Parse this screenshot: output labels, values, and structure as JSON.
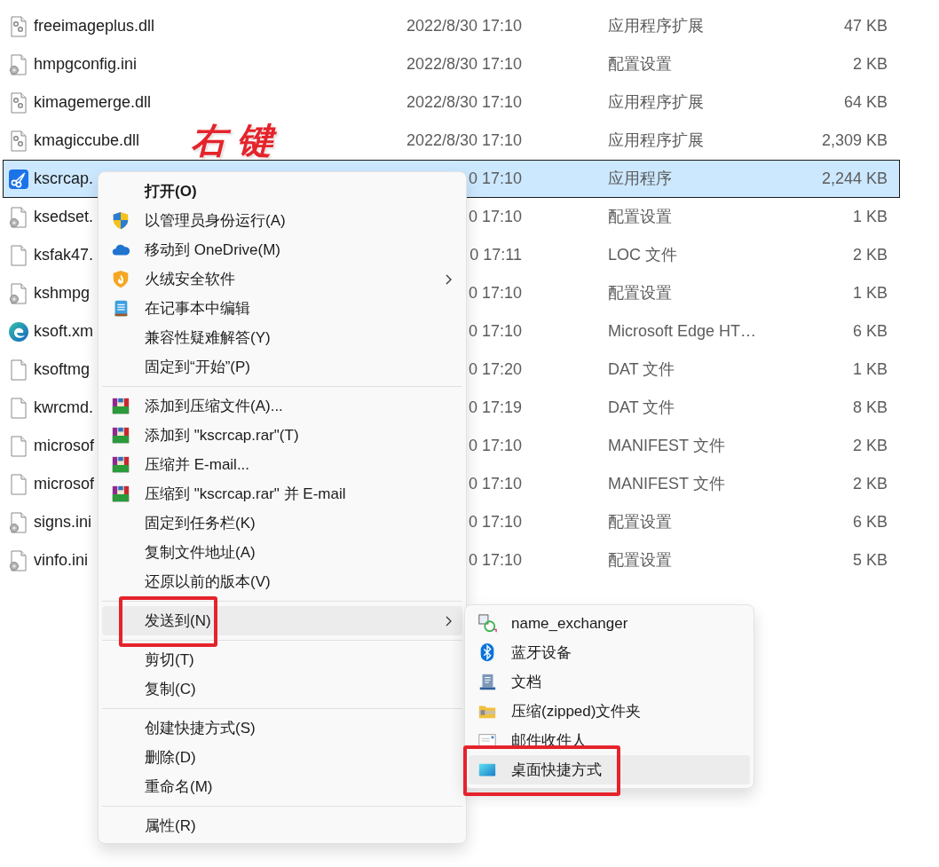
{
  "files": [
    {
      "name": "freeimageplus.dll",
      "date": "2022/8/30 17:10",
      "type": "应用程序扩展",
      "size": "47 KB",
      "kind": "dll",
      "selected": false
    },
    {
      "name": "hmpgconfig.ini",
      "date": "2022/8/30 17:10",
      "type": "配置设置",
      "size": "2 KB",
      "kind": "ini",
      "selected": false
    },
    {
      "name": "kimagemerge.dll",
      "date": "2022/8/30 17:10",
      "type": "应用程序扩展",
      "size": "64 KB",
      "kind": "dll",
      "selected": false
    },
    {
      "name": "kmagiccube.dll",
      "date": "2022/8/30 17:10",
      "type": "应用程序扩展",
      "size": "2,309 KB",
      "kind": "dll",
      "selected": false,
      "annotation": "右键"
    },
    {
      "name": "kscrcap.",
      "date": "0 17:10",
      "type": "应用程序",
      "size": "2,244 KB",
      "kind": "scissors",
      "selected": true
    },
    {
      "name": "ksedset.",
      "date": "0 17:10",
      "type": "配置设置",
      "size": "1 KB",
      "kind": "ini",
      "selected": false
    },
    {
      "name": "ksfak47.",
      "date": "0 17:11",
      "type": "LOC 文件",
      "size": "2 KB",
      "kind": "blank",
      "selected": false
    },
    {
      "name": "kshmpg",
      "date": "0 17:10",
      "type": "配置设置",
      "size": "1 KB",
      "kind": "ini",
      "selected": false
    },
    {
      "name": "ksoft.xm",
      "date": "0 17:10",
      "type": "Microsoft Edge HT…",
      "size": "6 KB",
      "kind": "edge",
      "selected": false
    },
    {
      "name": "ksoftmg",
      "date": "0 17:20",
      "type": "DAT 文件",
      "size": "1 KB",
      "kind": "blank",
      "selected": false
    },
    {
      "name": "kwrcmd.",
      "date": "0 17:19",
      "type": "DAT 文件",
      "size": "8 KB",
      "kind": "blank",
      "selected": false
    },
    {
      "name": "microsof",
      "date": "0 17:10",
      "type": "MANIFEST 文件",
      "size": "2 KB",
      "kind": "blank",
      "selected": false
    },
    {
      "name": "microsof",
      "date": "0 17:10",
      "type": "MANIFEST 文件",
      "size": "2 KB",
      "kind": "blank",
      "selected": false
    },
    {
      "name": "signs.ini",
      "date": "0 17:10",
      "type": "配置设置",
      "size": "6 KB",
      "kind": "ini",
      "selected": false
    },
    {
      "name": "vinfo.ini",
      "date": "0 17:10",
      "type": "配置设置",
      "size": "5 KB",
      "kind": "ini",
      "selected": false
    }
  ],
  "context_menu": {
    "groups": [
      [
        {
          "label": "打开(O)",
          "kind": "plain",
          "default": true,
          "has_submenu": false,
          "hovered": false,
          "highlighted": false
        },
        {
          "label": "以管理员身份运行(A)",
          "kind": "shield",
          "default": false,
          "has_submenu": false,
          "hovered": false,
          "highlighted": false
        },
        {
          "label": "移动到 OneDrive(M)",
          "kind": "cloud",
          "default": false,
          "has_submenu": false,
          "hovered": false,
          "highlighted": false
        },
        {
          "label": "火绒安全软件",
          "kind": "flame",
          "default": false,
          "has_submenu": true,
          "hovered": false,
          "highlighted": false
        },
        {
          "label": "在记事本中编辑",
          "kind": "notepad",
          "default": false,
          "has_submenu": false,
          "hovered": false,
          "highlighted": false
        },
        {
          "label": "兼容性疑难解答(Y)",
          "kind": "plain",
          "default": false,
          "has_submenu": false,
          "hovered": false,
          "highlighted": false
        },
        {
          "label": "固定到“开始”(P)",
          "kind": "plain",
          "default": false,
          "has_submenu": false,
          "hovered": false,
          "highlighted": false
        }
      ],
      [
        {
          "label": "添加到压缩文件(A)...",
          "kind": "archive",
          "default": false,
          "has_submenu": false,
          "hovered": false,
          "highlighted": false
        },
        {
          "label": "添加到 \"kscrcap.rar\"(T)",
          "kind": "archive",
          "default": false,
          "has_submenu": false,
          "hovered": false,
          "highlighted": false
        },
        {
          "label": "压缩并 E-mail...",
          "kind": "archive",
          "default": false,
          "has_submenu": false,
          "hovered": false,
          "highlighted": false
        },
        {
          "label": "压缩到 \"kscrcap.rar\" 并 E-mail",
          "kind": "archive",
          "default": false,
          "has_submenu": false,
          "hovered": false,
          "highlighted": false
        },
        {
          "label": "固定到任务栏(K)",
          "kind": "plain",
          "default": false,
          "has_submenu": false,
          "hovered": false,
          "highlighted": false
        },
        {
          "label": "复制文件地址(A)",
          "kind": "plain",
          "default": false,
          "has_submenu": false,
          "hovered": false,
          "highlighted": false
        },
        {
          "label": "还原以前的版本(V)",
          "kind": "plain",
          "default": false,
          "has_submenu": false,
          "hovered": false,
          "highlighted": false
        }
      ],
      [
        {
          "label": "发送到(N)",
          "kind": "plain",
          "default": false,
          "has_submenu": true,
          "hovered": true,
          "highlighted": true
        }
      ],
      [
        {
          "label": "剪切(T)",
          "kind": "plain",
          "default": false,
          "has_submenu": false,
          "hovered": false,
          "highlighted": false
        },
        {
          "label": "复制(C)",
          "kind": "plain",
          "default": false,
          "has_submenu": false,
          "hovered": false,
          "highlighted": false
        }
      ],
      [
        {
          "label": "创建快捷方式(S)",
          "kind": "plain",
          "default": false,
          "has_submenu": false,
          "hovered": false,
          "highlighted": false
        },
        {
          "label": "删除(D)",
          "kind": "plain",
          "default": false,
          "has_submenu": false,
          "hovered": false,
          "highlighted": false
        },
        {
          "label": "重命名(M)",
          "kind": "plain",
          "default": false,
          "has_submenu": false,
          "hovered": false,
          "highlighted": false
        }
      ],
      [
        {
          "label": "属性(R)",
          "kind": "plain",
          "default": false,
          "has_submenu": false,
          "hovered": false,
          "highlighted": false
        }
      ]
    ]
  },
  "send_to_menu": {
    "items": [
      {
        "label": "name_exchanger",
        "kind": "swap",
        "hovered": false,
        "highlighted": false
      },
      {
        "label": "蓝牙设备",
        "kind": "bluetooth",
        "hovered": false,
        "highlighted": false
      },
      {
        "label": "文档",
        "kind": "document",
        "hovered": false,
        "highlighted": false
      },
      {
        "label": "压缩(zipped)文件夹",
        "kind": "zipfolder",
        "hovered": false,
        "highlighted": false
      },
      {
        "label": "邮件收件人",
        "kind": "mail",
        "hovered": false,
        "highlighted": false
      },
      {
        "label": "桌面快捷方式",
        "kind": "desktop",
        "hovered": true,
        "highlighted": true
      }
    ]
  }
}
